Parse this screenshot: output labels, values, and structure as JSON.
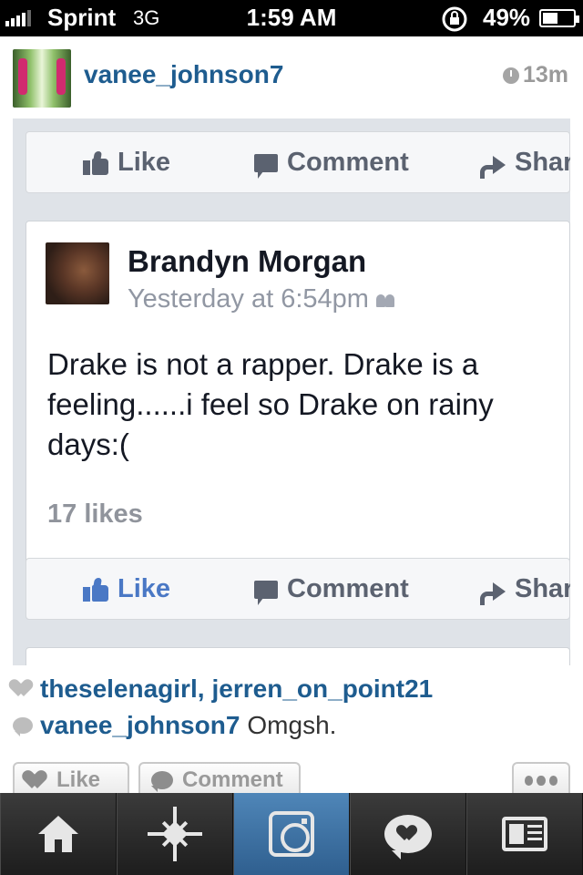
{
  "status_bar": {
    "carrier": "Sprint",
    "network": "3G",
    "time": "1:59 AM",
    "battery": "49%",
    "battery_level": 0.49,
    "icons": [
      "signal-icon",
      "rotation-lock-icon",
      "battery-icon"
    ]
  },
  "post": {
    "username": "vanee_johnson7",
    "time_ago": "13m"
  },
  "fb_screenshot": {
    "top_actions": {
      "like": "Like",
      "comment": "Comment",
      "share": "Shar"
    },
    "author": "Brandyn Morgan",
    "timestamp": "Yesterday at 6:54pm",
    "body": "Drake is not a rapper. Drake is a feeling......i feel so Drake on rainy days:(",
    "likes": "17 likes",
    "bottom_actions": {
      "like": "Like",
      "comment": "Comment",
      "share": "Shar"
    },
    "liked": true,
    "colors": {
      "liked": "#4a78c5",
      "text": "#141823",
      "muted": "#9197a3"
    }
  },
  "likes_line": {
    "user1": "theselenagirl",
    "separator": ", ",
    "user2": "jerren_on_point21"
  },
  "comment": {
    "author": "vanee_johnson7",
    "text": "Omgsh."
  },
  "buttons": {
    "like": "Like",
    "comment": "Comment",
    "more_icon": "more-icon"
  },
  "tab_bar": {
    "tabs": [
      "home-icon",
      "explore-icon",
      "camera-icon",
      "news-icon",
      "profile-icon"
    ],
    "active": 2,
    "active_color": "#3f74a6"
  },
  "colors": {
    "username": "#1e5c8f"
  }
}
